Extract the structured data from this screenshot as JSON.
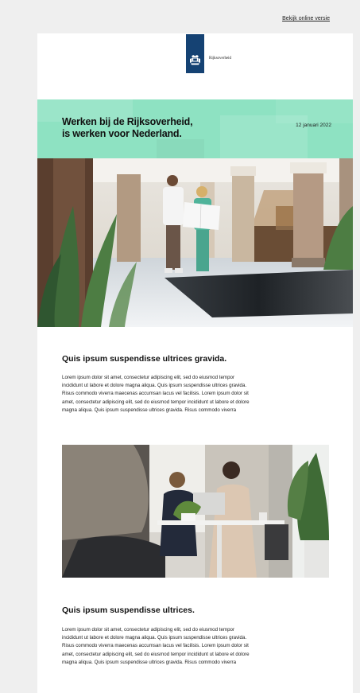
{
  "header": {
    "online_link": "Bekijk online versie"
  },
  "logo": {
    "text": "Rijksoverheid",
    "brand_color": "#154273"
  },
  "banner": {
    "title": "Werken bij de Rijksoverheid,\nis werken voor Nederland.",
    "date": "12 januari 2022",
    "color": "#8ee2c2"
  },
  "images": {
    "hero": "photo-two-colleagues-reading-document-in-columned-hall",
    "office": "photo-women-meeting-at-table-with-laptop"
  },
  "sections": [
    {
      "title": "Quis ipsum suspendisse ultrices gravida.",
      "lines": [
        "Lorem ipsum dolor sit amet, consectetur adipiscing elit, sed do eiusmod tempor",
        "incididunt ut labore et dolore magna aliqua. Quis ipsum suspendisse ultrices gravida.",
        "Risus commodo viverra maecenas accumsan lacus vel facilisis. Lorem ipsum dolor sit",
        "amet, consectetur adipiscing elit, sed do eiusmod tempor incididunt ut labore et dolore",
        "magna aliqua. Quis ipsum suspendisse ultrices gravida. Risus commodo viverra"
      ]
    },
    {
      "title": "Quis ipsum suspendisse ultrices.",
      "lines": [
        "Lorem ipsum dolor sit amet, consectetur adipiscing elit, sed do eiusmod tempor",
        "incididunt ut labore et dolore magna aliqua. Quis ipsum suspendisse ultrices gravida.",
        "Risus commodo viverra maecenas accumsan lacus vel facilisis. Lorem ipsum dolor sit",
        "amet, consectetur adipiscing elit, sed do eiusmod tempor incididunt ut labore et dolore",
        "magna aliqua. Quis ipsum suspendisse ultrices gravida. Risus commodo viverra"
      ]
    }
  ]
}
